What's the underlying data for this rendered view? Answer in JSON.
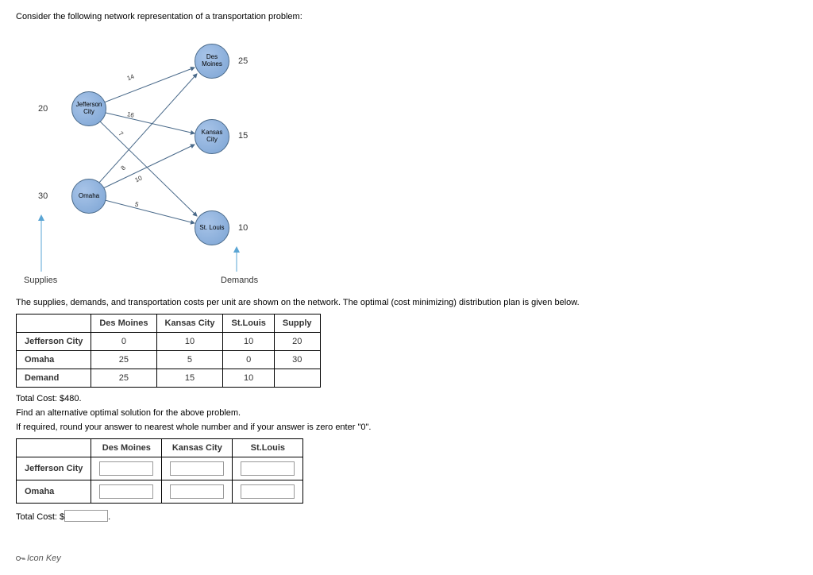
{
  "intro": "Consider the following network representation of a transportation problem:",
  "diagram": {
    "nodes": {
      "jefferson": "Jefferson City",
      "omaha": "Omaha",
      "desmoines": "Des Moines",
      "kansas": "Kansas City",
      "stlouis": "St. Louis"
    },
    "supply_jefferson": "20",
    "supply_omaha": "30",
    "demand_desmoines": "25",
    "demand_kansas": "15",
    "demand_stlouis": "10",
    "edge_jc_dm": "14",
    "edge_jc_kc": "16",
    "edge_jc_sl": "7",
    "edge_om_dm": "8",
    "edge_om_kc": "10",
    "edge_om_sl": "5",
    "supplies_label": "Supplies",
    "demands_label": "Demands"
  },
  "description": "The supplies, demands, and transportation costs per unit are shown on the network. The optimal (cost minimizing) distribution plan is given below.",
  "table1": {
    "headers": [
      "",
      "Des Moines",
      "Kansas City",
      "St.Louis",
      "Supply"
    ],
    "rows": [
      {
        "label": "Jefferson City",
        "c1": "0",
        "c2": "10",
        "c3": "10",
        "c4": "20"
      },
      {
        "label": "Omaha",
        "c1": "25",
        "c2": "5",
        "c3": "0",
        "c4": "30"
      },
      {
        "label": "Demand",
        "c1": "25",
        "c2": "15",
        "c3": "10",
        "c4": ""
      }
    ]
  },
  "total_cost_given": "Total Cost: $480.",
  "instruction1": "Find an alternative optimal solution for the above problem.",
  "instruction2": "If required, round your answer to nearest whole number and if your answer is zero enter \"0\".",
  "table2": {
    "headers": [
      "",
      "Des Moines",
      "Kansas City",
      "St.Louis"
    ],
    "rows": [
      {
        "label": "Jefferson City"
      },
      {
        "label": "Omaha"
      }
    ]
  },
  "total_cost_label": "Total Cost: $",
  "period": ".",
  "icon_key": "Icon Key"
}
